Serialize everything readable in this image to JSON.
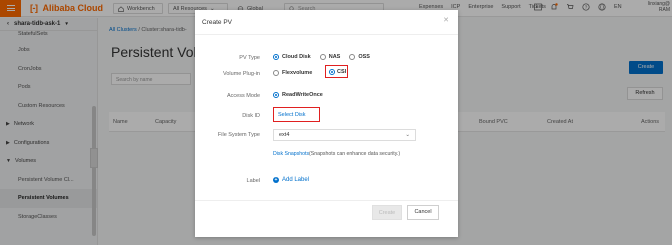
{
  "topbar": {
    "logo": "Alibaba Cloud",
    "workbench": "Workbench",
    "all_resources": "All Resources",
    "global": "Global",
    "search_placeholder": "Search",
    "links": [
      "Expenses",
      "ICP",
      "Enterprise",
      "Support",
      "Tickets"
    ],
    "lang": "EN",
    "user_name": "linxiang@",
    "user_role": "RAM"
  },
  "sidebar": {
    "cluster": "shara-tidb-ask-1",
    "items": [
      {
        "label": "StatefulSets",
        "type": "item"
      },
      {
        "label": "Jobs",
        "type": "item"
      },
      {
        "label": "CronJobs",
        "type": "item"
      },
      {
        "label": "Pods",
        "type": "item"
      },
      {
        "label": "Custom Resources",
        "type": "item"
      },
      {
        "label": "Network",
        "type": "group",
        "expanded": false
      },
      {
        "label": "Configurations",
        "type": "group",
        "expanded": false
      },
      {
        "label": "Volumes",
        "type": "group",
        "expanded": true
      },
      {
        "label": "Persistent Volume Cl...",
        "type": "item"
      },
      {
        "label": "Persistent Volumes",
        "type": "item",
        "active": true
      },
      {
        "label": "StorageClasses",
        "type": "item"
      }
    ]
  },
  "main": {
    "crumb_root": "All Clusters",
    "crumb_sep": "/",
    "crumb_cluster": "Cluster:shara-tidb-",
    "title": "Persistent Volu",
    "search_placeholder": "Search by name",
    "create_label": "Create",
    "refresh_label": "Refresh",
    "columns": [
      "Name",
      "Capacity",
      "Bound PVC",
      "Created At",
      "Actions"
    ]
  },
  "modal": {
    "title": "Create PV",
    "pv_type_label": "PV Type",
    "pv_types": [
      {
        "label": "Cloud Disk",
        "selected": true
      },
      {
        "label": "NAS",
        "selected": false
      },
      {
        "label": "OSS",
        "selected": false
      }
    ],
    "plugin_label": "Volume Plug-in",
    "plugins": [
      {
        "label": "Flexvolume",
        "selected": false
      },
      {
        "label": "CSI",
        "selected": true
      }
    ],
    "access_mode_label": "Access Mode",
    "access_mode_value": "ReadWriteOnce",
    "disk_id_label": "Disk ID",
    "select_disk": "Select Disk",
    "fs_type_label": "File System Type",
    "fs_type_value": "ext4",
    "hint_link": "Disk Snapshots",
    "hint_text": "(Snapshots can enhance data security.)",
    "label_label": "Label",
    "add_label": "Add Label",
    "create_label": "Create",
    "cancel_label": "Cancel"
  },
  "colors": {
    "brand": "#ff6a00",
    "primary": "#0070cc",
    "highlight": "#e02020"
  }
}
